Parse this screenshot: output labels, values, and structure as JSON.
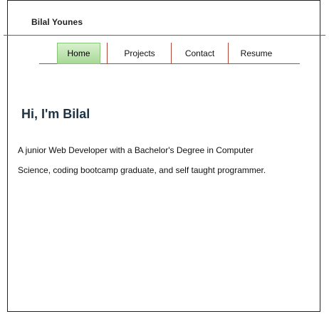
{
  "header": {
    "brand": "Bilal Younes"
  },
  "nav": {
    "items": [
      {
        "label": "Home",
        "active": true
      },
      {
        "label": "Projects",
        "active": false
      },
      {
        "label": "Contact",
        "active": false
      },
      {
        "label": "Resume",
        "active": false
      }
    ]
  },
  "main": {
    "heading": "Hi, I'm Bilal",
    "intro_line1": "A junior Web Developer with a Bachelor's Degree in Computer",
    "intro_line2": "Science, coding bootcamp graduate, and self taught programmer."
  },
  "colors": {
    "accent_rule": "#b5473a",
    "active_tab_bg": "#a8d997",
    "heading": "#1e3344"
  }
}
